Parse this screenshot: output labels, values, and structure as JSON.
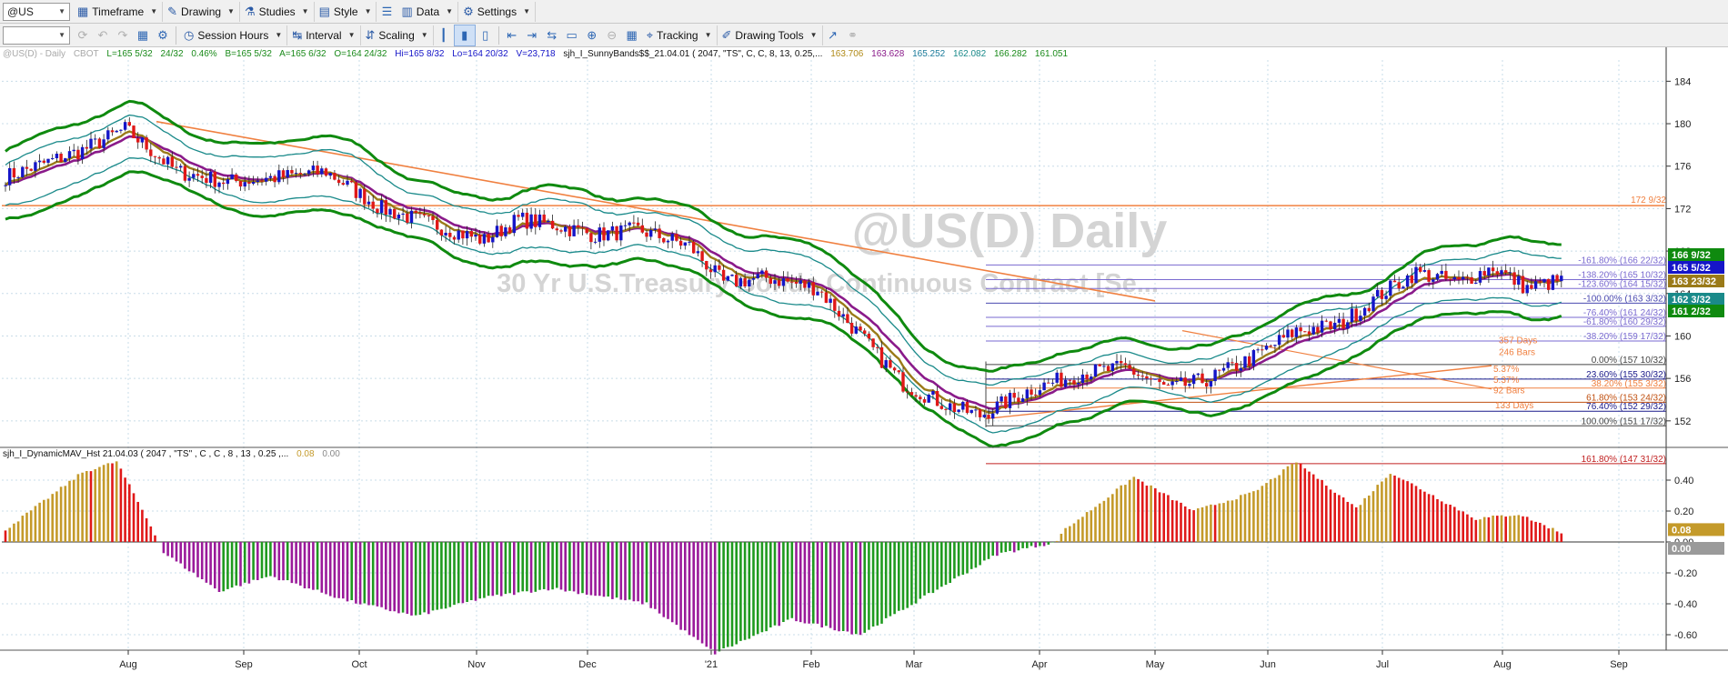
{
  "toolbar1": {
    "symbol": "@US",
    "timeframe": "Timeframe",
    "drawing": "Drawing",
    "studies": "Studies",
    "style": "Style",
    "data": "Data",
    "settings": "Settings"
  },
  "toolbar2": {
    "session_hours": "Session Hours",
    "interval": "Interval",
    "scaling": "Scaling",
    "tracking": "Tracking",
    "drawing_tools": "Drawing Tools"
  },
  "info": {
    "symbol": "@US(D) - Daily",
    "exchange": "CBOT",
    "last": "L=165 5/32",
    "change": "24/32",
    "change_pct": "0.46%",
    "bid": "B=165 5/32",
    "ask": "A=165 6/32",
    "open": "O=164 24/32",
    "high": "Hi=165 8/32",
    "low": "Lo=164 20/32",
    "volume": "V=23,718",
    "study": "sjh_I_SunnyBands$$_21.04.01 (  2047, \"TS\",  C,  C,    8,  13,  0.25,...",
    "v1": "163.706",
    "v2": "163.628",
    "v3": "165.252",
    "v4": "162.082",
    "v5": "166.282",
    "v6": "161.051"
  },
  "indicator2": {
    "name": "sjh_I_DynamicMAV_Hst 21.04.03 ( 2047 , \"TS\" , C , C ,  8 , 13 , 0.25 ,...",
    "v1": "0.08",
    "v2": "0.00"
  },
  "watermark": {
    "title": "@US(D) Daily",
    "subtitle": "30 Yr U.S.Treasury Bonds Continuous Contract [Se..."
  },
  "colors": {
    "up": "#1515c8",
    "down": "#e01818",
    "green": "#0f8a0f",
    "purple": "#8a1a8a",
    "olive": "#9a7a18",
    "teal": "#1a8a8a",
    "trend": "#f08040",
    "hist_red": "#e01818",
    "hist_gold": "#c49a2a",
    "hist_green": "#1f9a1f",
    "hist_purple": "#9a1a9a"
  },
  "chart_data": {
    "type": "candlestick",
    "symbol": "@US(D) - Daily",
    "price_axis": {
      "range": [
        149.5,
        186
      ],
      "ticks": [
        "184",
        "180",
        "176",
        "172",
        "168",
        "164",
        "160",
        "156",
        "152"
      ]
    },
    "x_axis": {
      "labels": [
        "Aug",
        "Sep",
        "Oct",
        "Nov",
        "Dec",
        "'21",
        "Feb",
        "Mar",
        "Apr",
        "May",
        "Jun",
        "Jul",
        "Aug",
        "Sep"
      ]
    },
    "close_path": [
      {
        "day": 0,
        "price": 175.0
      },
      {
        "day": 18,
        "price": 177.5
      },
      {
        "day": 28,
        "price": 179.5
      },
      {
        "day": 40,
        "price": 175.5
      },
      {
        "day": 52,
        "price": 174.5
      },
      {
        "day": 65,
        "price": 175.0
      },
      {
        "day": 75,
        "price": 175.5
      },
      {
        "day": 88,
        "price": 172.0
      },
      {
        "day": 100,
        "price": 170.5
      },
      {
        "day": 112,
        "price": 169.0
      },
      {
        "day": 120,
        "price": 171.0
      },
      {
        "day": 128,
        "price": 170.5
      },
      {
        "day": 138,
        "price": 169.5
      },
      {
        "day": 148,
        "price": 170.0
      },
      {
        "day": 160,
        "price": 168.5
      },
      {
        "day": 168,
        "price": 165.0
      },
      {
        "day": 178,
        "price": 165.5
      },
      {
        "day": 190,
        "price": 164.5
      },
      {
        "day": 200,
        "price": 160.0
      },
      {
        "day": 210,
        "price": 155.5
      },
      {
        "day": 220,
        "price": 153.5
      },
      {
        "day": 228,
        "price": 152.5
      },
      {
        "day": 240,
        "price": 155.0
      },
      {
        "day": 252,
        "price": 156.5
      },
      {
        "day": 262,
        "price": 157.0
      },
      {
        "day": 272,
        "price": 155.0
      },
      {
        "day": 282,
        "price": 156.0
      },
      {
        "day": 292,
        "price": 158.0
      },
      {
        "day": 302,
        "price": 160.5
      },
      {
        "day": 312,
        "price": 161.0
      },
      {
        "day": 322,
        "price": 164.0
      },
      {
        "day": 330,
        "price": 166.0
      },
      {
        "day": 340,
        "price": 165.0
      },
      {
        "day": 348,
        "price": 166.5
      },
      {
        "day": 356,
        "price": 164.5
      },
      {
        "day": 363,
        "price": 165.16
      }
    ],
    "bands": [
      {
        "name": "upper-outer",
        "offset": 3.2
      },
      {
        "name": "upper-inner",
        "offset": 1.9
      },
      {
        "name": "lower-inner",
        "offset": -1.9
      },
      {
        "name": "lower-outer",
        "offset": -3.2
      }
    ],
    "horizontal_line": {
      "price": 172.28,
      "label": "172 9/32"
    },
    "fib_levels": [
      {
        "pct": "-161.80%",
        "label": "-161.80% (166 22/32)",
        "price": 166.69,
        "color": "#7a6ad0"
      },
      {
        "pct": "-138.20%",
        "label": "-138.20% (165 10/32)",
        "price": 165.31,
        "color": "#7a6ad0"
      },
      {
        "pct": "-123.60%",
        "label": "-123.60% (164 15/32)",
        "price": 164.47,
        "color": "#7a6ad0"
      },
      {
        "pct": "-100.00%",
        "label": "-100.00% (163 3/32)",
        "price": 163.09,
        "color": "#4a4ab0"
      },
      {
        "pct": "-76.40%",
        "label": "-76.40% (161 24/32)",
        "price": 161.75,
        "color": "#7a6ad0"
      },
      {
        "pct": "-61.80%",
        "label": "-61.80% (160 29/32)",
        "price": 160.91,
        "color": "#7a6ad0"
      },
      {
        "pct": "-38.20%",
        "label": "-38.20% (159 17/32)",
        "price": 159.53,
        "color": "#7a6ad0"
      },
      {
        "pct": "0.00%",
        "label": "0.00% (157 10/32)",
        "price": 157.31,
        "color": "#444444"
      },
      {
        "pct": "23.60%",
        "label": "23.60% (155 30/32)",
        "price": 155.94,
        "color": "#1a1a8a"
      },
      {
        "pct": "38.20%",
        "label": "38.20% (155 3/32)",
        "price": 155.09,
        "color": "#f08040"
      },
      {
        "pct": "61.80%",
        "label": "61.80% (153 24/32)",
        "price": 153.75,
        "color": "#c05010"
      },
      {
        "pct": "76.40%",
        "label": "76.40% (152 29/32)",
        "price": 152.91,
        "color": "#1a1a8a"
      },
      {
        "pct": "100.00%",
        "label": "100.00% (151 17/32)",
        "price": 151.53,
        "color": "#444444"
      },
      {
        "pct": "161.80%",
        "label": "161.80% (147 31/32)",
        "price": 147.97,
        "color": "#c02020"
      }
    ],
    "time_annotations": [
      "357 Days",
      "246 Bars",
      "92 Bars",
      "133 Days",
      "5.37%",
      "5.37%"
    ],
    "right_price_tags": [
      {
        "label": "166 9/32",
        "price": 166.28,
        "bg": "#0f8a0f"
      },
      {
        "label": "165 5/32",
        "price": 165.16,
        "bg": "#1515c8"
      },
      {
        "label": "163 23/32",
        "price": 163.72,
        "bg": "#9a7a18"
      },
      {
        "label": "162 3/32",
        "price": 162.09,
        "bg": "#1a8a8a"
      },
      {
        "label": "161 2/32",
        "price": 161.06,
        "bg": "#0f8a0f"
      }
    ],
    "histogram": {
      "range": [
        -0.72,
        0.6
      ],
      "ticks": [
        "0.40",
        "0.20",
        "0.00",
        "-0.20",
        "-0.40",
        "-0.60"
      ],
      "last_values": [
        "0.08",
        "0.00"
      ],
      "segments": [
        {
          "from": 0,
          "to": 18,
          "start": 0.08,
          "end": 0.45
        },
        {
          "from": 18,
          "to": 26,
          "start": 0.45,
          "end": 0.52
        },
        {
          "from": 26,
          "to": 36,
          "start": 0.52,
          "end": 0.0
        },
        {
          "from": 36,
          "to": 50,
          "start": -0.05,
          "end": -0.32
        },
        {
          "from": 50,
          "to": 62,
          "start": -0.32,
          "end": -0.22
        },
        {
          "from": 62,
          "to": 80,
          "start": -0.22,
          "end": -0.38
        },
        {
          "from": 80,
          "to": 96,
          "start": -0.38,
          "end": -0.48
        },
        {
          "from": 96,
          "to": 112,
          "start": -0.48,
          "end": -0.36
        },
        {
          "from": 112,
          "to": 128,
          "start": -0.36,
          "end": -0.3
        },
        {
          "from": 128,
          "to": 150,
          "start": -0.3,
          "end": -0.4
        },
        {
          "from": 150,
          "to": 166,
          "start": -0.4,
          "end": -0.72
        },
        {
          "from": 166,
          "to": 184,
          "start": -0.72,
          "end": -0.5
        },
        {
          "from": 184,
          "to": 200,
          "start": -0.5,
          "end": -0.6
        },
        {
          "from": 200,
          "to": 232,
          "start": -0.6,
          "end": -0.08
        },
        {
          "from": 232,
          "to": 246,
          "start": -0.08,
          "end": 0.0
        },
        {
          "from": 246,
          "to": 264,
          "start": 0.04,
          "end": 0.42
        },
        {
          "from": 264,
          "to": 278,
          "start": 0.42,
          "end": 0.2
        },
        {
          "from": 278,
          "to": 292,
          "start": 0.2,
          "end": 0.32
        },
        {
          "from": 292,
          "to": 302,
          "start": 0.32,
          "end": 0.52
        },
        {
          "from": 302,
          "to": 316,
          "start": 0.52,
          "end": 0.22
        },
        {
          "from": 316,
          "to": 324,
          "start": 0.22,
          "end": 0.45
        },
        {
          "from": 324,
          "to": 344,
          "start": 0.45,
          "end": 0.15
        },
        {
          "from": 344,
          "to": 354,
          "start": 0.15,
          "end": 0.18
        },
        {
          "from": 354,
          "to": 364,
          "start": 0.18,
          "end": 0.06
        }
      ]
    }
  }
}
